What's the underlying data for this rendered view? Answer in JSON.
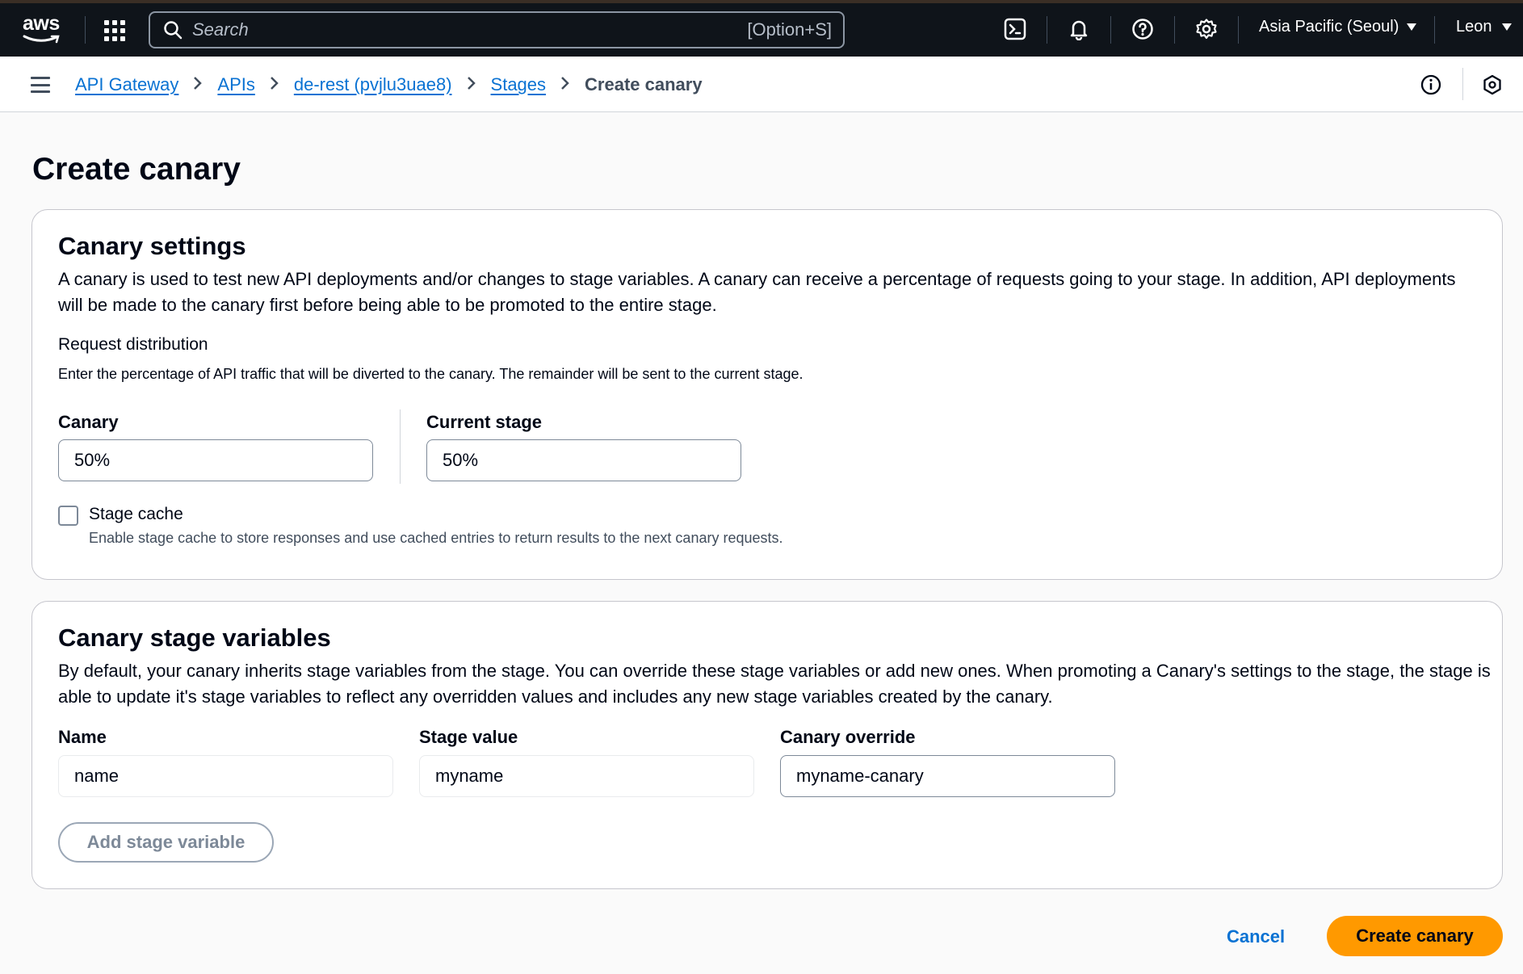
{
  "topbar": {
    "logo_text": "aws",
    "search_placeholder": "Search",
    "search_shortcut": "[Option+S]",
    "region": "Asia Pacific (Seoul)",
    "user": "Leon"
  },
  "breadcrumb": {
    "items": [
      "API Gateway",
      "APIs",
      "de-rest (pvjlu3uae8)",
      "Stages"
    ],
    "current": "Create canary"
  },
  "page": {
    "title": "Create canary"
  },
  "canary_settings": {
    "title": "Canary settings",
    "description": "A canary is used to test new API deployments and/or changes to stage variables. A canary can receive a percentage of requests going to your stage. In addition, API deployments will be made to the canary first before being able to be promoted to the entire stage.",
    "request_distribution": {
      "label": "Request distribution",
      "help": "Enter the percentage of API traffic that will be diverted to the canary. The remainder will be sent to the current stage.",
      "canary_label": "Canary",
      "canary_value": "50%",
      "current_stage_label": "Current stage",
      "current_stage_value": "50%"
    },
    "stage_cache": {
      "label": "Stage cache",
      "help": "Enable stage cache to store responses and use cached entries to return results to the next canary requests.",
      "checked": false
    }
  },
  "stage_variables": {
    "title": "Canary stage variables",
    "description": "By default, your canary inherits stage variables from the stage. You can override these stage variables or add new ones. When promoting a Canary's settings to the stage, the stage is able to update it's stage variables to reflect any overridden values and includes any new stage variables created by the canary.",
    "columns": [
      "Name",
      "Stage value",
      "Canary override"
    ],
    "rows": [
      {
        "name": "name",
        "stage_value": "myname",
        "canary_override": "myname-canary"
      }
    ],
    "add_button": "Add stage variable"
  },
  "actions": {
    "cancel": "Cancel",
    "create": "Create canary"
  },
  "colors": {
    "primary": "#ff9900",
    "link": "#0972d3",
    "nav_bg": "#0f141a"
  }
}
